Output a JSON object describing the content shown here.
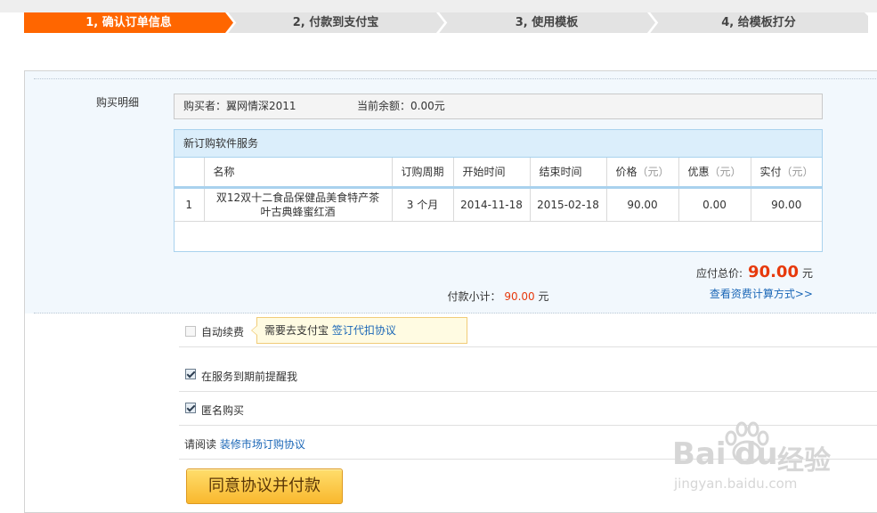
{
  "steps": [
    {
      "label": "1, 确认订单信息",
      "active": true
    },
    {
      "label": "2, 付款到支付宝",
      "active": false
    },
    {
      "label": "3, 使用模板",
      "active": false
    },
    {
      "label": "4, 给模板打分",
      "active": false
    }
  ],
  "colors": {
    "active_step": "#ff6600",
    "inactive_step": "#e3e3e3",
    "price_red": "#e7390c",
    "link_blue": "#1b67b7"
  },
  "purchase_detail": {
    "label": "购买明细",
    "buyer_label": "购买者：",
    "buyer_name": "翼网情深2011",
    "balance_label": "当前余额：",
    "balance_value": "0.00元"
  },
  "order": {
    "title": "新订购软件服务",
    "columns": [
      "",
      "名称",
      "订购周期",
      "开始时间",
      "结束时间",
      "价格",
      "优惠",
      "实付"
    ],
    "unit": "（元）",
    "rows": [
      {
        "index": "1",
        "name": "双12双十二食品保健品美食特产茶叶古典蜂蜜红酒",
        "period": "3 个月",
        "start": "2014-11-18",
        "end": "2015-02-18",
        "price": "90.00",
        "discount": "0.00",
        "paid": "90.00"
      }
    ],
    "subtotal_label": "付款小计：",
    "subtotal_value": "90.00",
    "subtotal_unit": "元"
  },
  "total": {
    "label": "应付总价:",
    "value": "90.00",
    "unit": "元",
    "calc_link": "查看资费计算方式>>"
  },
  "options": {
    "auto_renew": {
      "label": "自动续费",
      "checked": false
    },
    "auto_renew_tip": {
      "text": "需要去支付宝",
      "link": "签订代扣协议"
    },
    "remind": {
      "label": "在服务到期前提醒我",
      "checked": true
    },
    "anonymous": {
      "label": "匿名购买",
      "checked": true
    }
  },
  "agreement": {
    "prefix": "请阅读",
    "link": "装修市场订购协议"
  },
  "pay_button": "同意协议并付款",
  "watermark": {
    "brand": "Bai",
    "brand2": "du",
    "suffix": "经验",
    "url": "jingyan.baidu.com"
  }
}
